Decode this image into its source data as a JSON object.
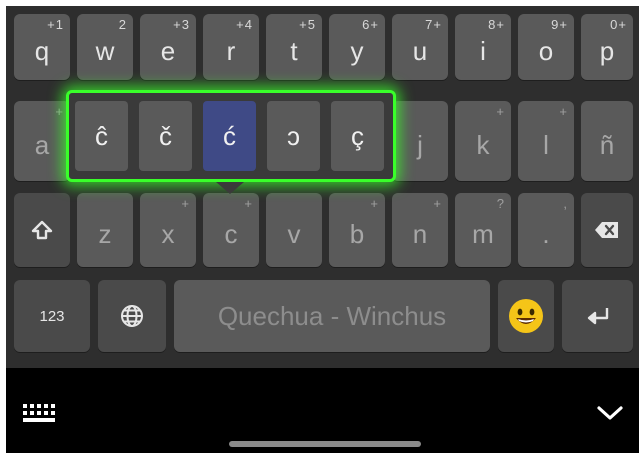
{
  "keyboard": {
    "row1": [
      {
        "label": "q",
        "hint": "+1"
      },
      {
        "label": "w",
        "hint": "2"
      },
      {
        "label": "e",
        "hint": "+3"
      },
      {
        "label": "r",
        "hint": "+4"
      },
      {
        "label": "t",
        "hint": "+5"
      },
      {
        "label": "y",
        "hint": "6+"
      },
      {
        "label": "u",
        "hint": "7+"
      },
      {
        "label": "i",
        "hint": "8+"
      },
      {
        "label": "o",
        "hint": "9+"
      },
      {
        "label": "p",
        "hint": "0+"
      }
    ],
    "row2": [
      {
        "label": "a",
        "hint": "+"
      },
      {
        "label": "j",
        "hint": ""
      },
      {
        "label": "k",
        "hint": "+"
      },
      {
        "label": "l",
        "hint": "+"
      },
      {
        "label": "ñ",
        "hint": ""
      }
    ],
    "row3": [
      {
        "label": "z",
        "hint": ""
      },
      {
        "label": "x",
        "hint": "+"
      },
      {
        "label": "c",
        "hint": "+"
      },
      {
        "label": "v",
        "hint": ""
      },
      {
        "label": "b",
        "hint": "+"
      },
      {
        "label": "n",
        "hint": "+"
      },
      {
        "label": "m",
        "hint": "?"
      },
      {
        "label": ".",
        "hint": ","
      }
    ],
    "numbers_label": "123",
    "space_label": "Quechua - Winchus"
  },
  "popup": {
    "variants": [
      "ĉ",
      "č",
      "ć",
      "ɔ",
      "ç"
    ],
    "selected_index": 2
  },
  "icons": {
    "shift": "shift-icon",
    "backspace": "backspace-icon",
    "globe": "globe-icon",
    "emoji": "emoji-icon",
    "enter": "enter-icon",
    "keyboard": "keyboard-icon",
    "hide": "chevron-down-icon"
  },
  "colors": {
    "key": "#5a5a5a",
    "background": "#2e2e2e",
    "highlight": "#39ff2a",
    "selected": "#3f4a86"
  }
}
